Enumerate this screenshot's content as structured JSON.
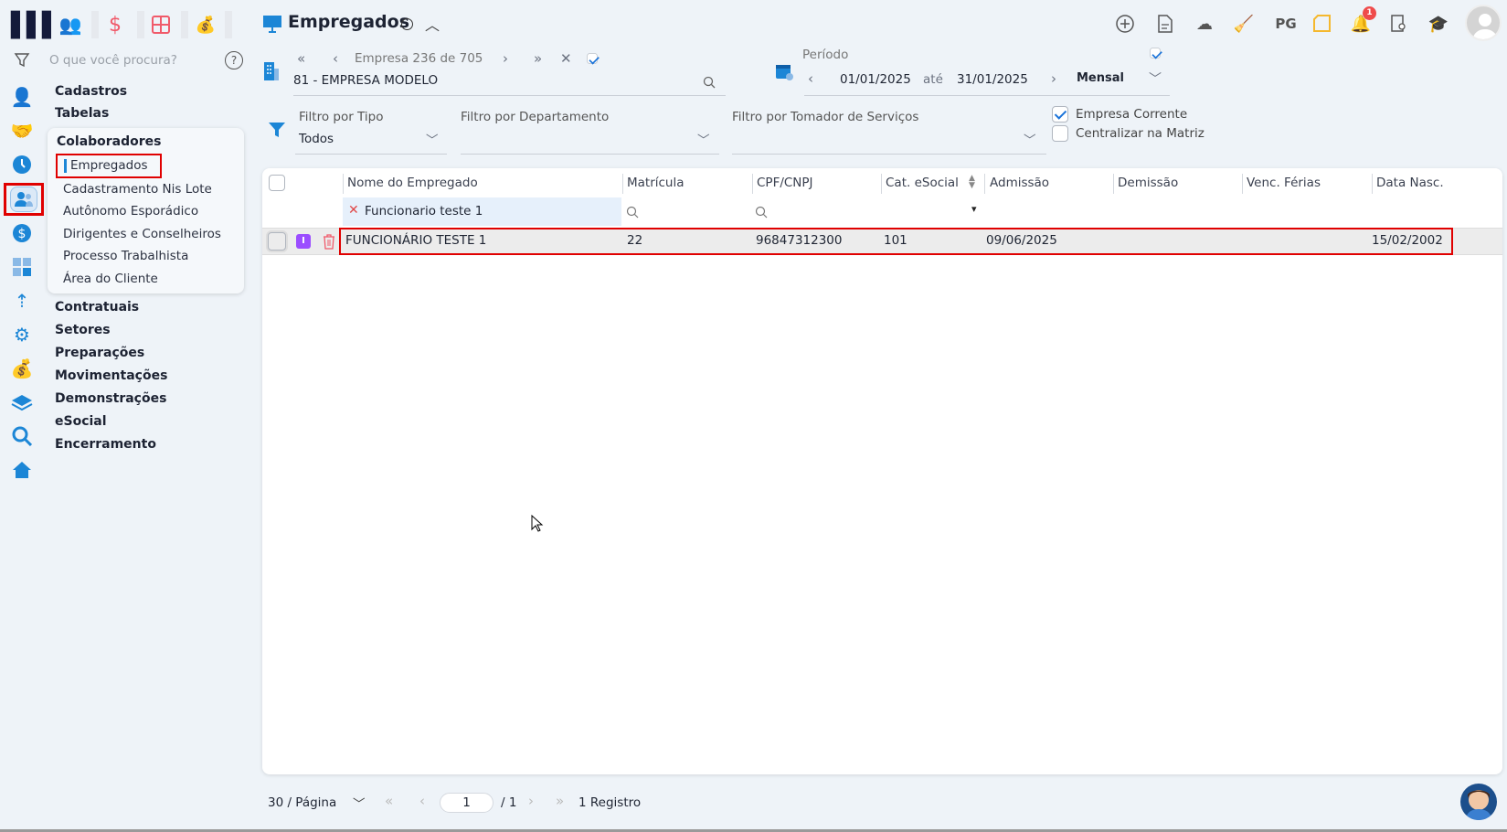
{
  "logo": "logo",
  "top_tabs": [
    {
      "icon": "people-icon"
    },
    {
      "icon": "dollar-icon"
    },
    {
      "icon": "calculator-icon"
    },
    {
      "icon": "money-bag-icon"
    }
  ],
  "search": {
    "placeholder": "O que você procura?"
  },
  "menu": {
    "top": [
      "Cadastros",
      "Tabelas"
    ],
    "flyout_title": "Colaboradores",
    "flyout_items": [
      "Empregados",
      "Cadastramento Nis Lote",
      "Autônomo Esporádico",
      "Dirigentes e Conselheiros",
      "Processo Trabalhista",
      "Área do Cliente"
    ],
    "bottom": [
      "Contratuais",
      "Setores",
      "Preparações",
      "Movimentações",
      "Demonstrações",
      "eSocial",
      "Encerramento"
    ]
  },
  "header": {
    "title": "Empregados",
    "company_nav": "Empresa 236 de 705",
    "company": "81 - EMPRESA MODELO",
    "period_label": "Período",
    "date_from": "01/01/2025",
    "date_sep": "até",
    "date_to": "31/01/2025",
    "periodicity": "Mensal",
    "pg_label": "PG",
    "notification_count": "1"
  },
  "filters": {
    "tipo_label": "Filtro por Tipo",
    "tipo_value": "Todos",
    "departamento_label": "Filtro por Departamento",
    "tomador_label": "Filtro por Tomador de Serviços",
    "empresa_corrente": "Empresa Corrente",
    "centralizar": "Centralizar na Matriz"
  },
  "table": {
    "columns": [
      "Nome do Empregado",
      "Matrícula",
      "CPF/CNPJ",
      "Cat. eSocial",
      "Admissão",
      "Demissão",
      "Venc. Férias",
      "Data Nasc."
    ],
    "name_filter": "Funcionario teste 1",
    "rows": [
      {
        "badge": "I",
        "nome": "FUNCIONÁRIO TESTE 1",
        "matricula": "22",
        "cpf": "96847312300",
        "cat": "101",
        "admissao": "09/06/2025",
        "demissao": "",
        "venc_ferias": "",
        "nascimento": "15/02/2002"
      }
    ]
  },
  "footer": {
    "page_size": "30 / Página",
    "page": "1",
    "total_pages": "/ 1",
    "records": "1 Registro"
  },
  "colors": {
    "accent": "#1c86d6",
    "highlight": "#e00000",
    "badge": "#9b4dff"
  }
}
